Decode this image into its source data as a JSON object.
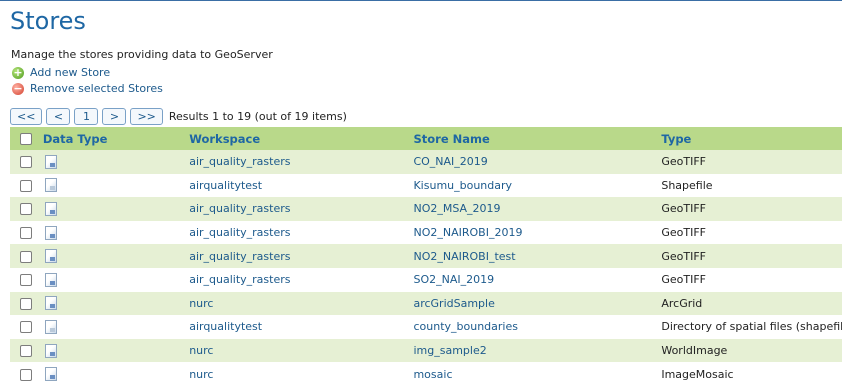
{
  "page": {
    "title": "Stores",
    "description": "Manage the stores providing data to GeoServer"
  },
  "actions": {
    "add": "Add new Store",
    "remove": "Remove selected Stores"
  },
  "pager": {
    "first": "<<",
    "prev": "<",
    "page": "1",
    "next": ">",
    "last": ">>",
    "info": "Results 1 to 19 (out of 19 items)"
  },
  "table": {
    "headers": {
      "data_type": "Data Type",
      "workspace": "Workspace",
      "store_name": "Store Name",
      "type": "Type"
    },
    "rows": [
      {
        "icon": "raster-store-icon",
        "workspace": "air_quality_rasters",
        "store": "CO_NAI_2019",
        "type": "GeoTIFF"
      },
      {
        "icon": "vector-store-icon",
        "workspace": "airqualitytest",
        "store": "Kisumu_boundary",
        "type": "Shapefile"
      },
      {
        "icon": "raster-store-icon",
        "workspace": "air_quality_rasters",
        "store": "NO2_MSA_2019",
        "type": "GeoTIFF"
      },
      {
        "icon": "raster-store-icon",
        "workspace": "air_quality_rasters",
        "store": "NO2_NAIROBI_2019",
        "type": "GeoTIFF"
      },
      {
        "icon": "raster-store-icon",
        "workspace": "air_quality_rasters",
        "store": "NO2_NAIROBI_test",
        "type": "GeoTIFF"
      },
      {
        "icon": "raster-store-icon",
        "workspace": "air_quality_rasters",
        "store": "SO2_NAI_2019",
        "type": "GeoTIFF"
      },
      {
        "icon": "raster-store-icon",
        "workspace": "nurc",
        "store": "arcGridSample",
        "type": "ArcGrid"
      },
      {
        "icon": "vector-store-icon",
        "workspace": "airqualitytest",
        "store": "county_boundaries",
        "type": "Directory of spatial files (shapefiles)"
      },
      {
        "icon": "raster-store-icon",
        "workspace": "nurc",
        "store": "img_sample2",
        "type": "WorldImage"
      },
      {
        "icon": "raster-store-icon",
        "workspace": "nurc",
        "store": "mosaic",
        "type": "ImageMosaic"
      }
    ]
  }
}
